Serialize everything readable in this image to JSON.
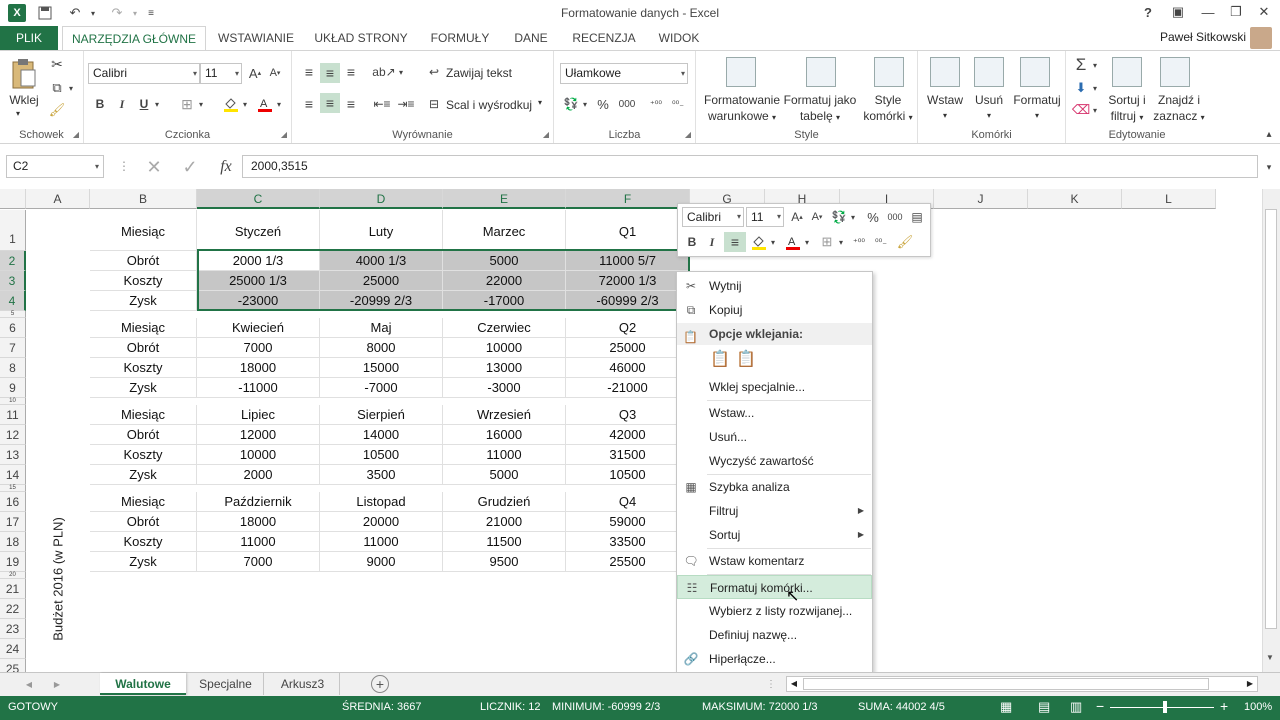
{
  "window": {
    "title": "Formatowanie danych - Excel",
    "help": "?",
    "user": "Paweł Sitkowski"
  },
  "tabs": [
    "PLIK",
    "NARZĘDZIA GŁÓWNE",
    "WSTAWIANIE",
    "UKŁAD STRONY",
    "FORMUŁY",
    "DANE",
    "RECENZJA",
    "WIDOK"
  ],
  "ribbon": {
    "clipboard": {
      "label": "Schowek",
      "paste": "Wklej"
    },
    "font": {
      "label": "Czcionka",
      "name": "Calibri",
      "size": "11"
    },
    "alignment": {
      "label": "Wyrównanie",
      "wrap": "Zawijaj tekst",
      "merge": "Scal i wyśrodkuj"
    },
    "number": {
      "label": "Liczba",
      "format": "Ułamkowe"
    },
    "styles": {
      "label": "Style",
      "cond1": "Formatowanie",
      "cond2": "warunkowe",
      "tbl1": "Formatuj jako",
      "tbl2": "tabelę",
      "cell1": "Style",
      "cell2": "komórki"
    },
    "cells": {
      "label": "Komórki",
      "insert": "Wstaw",
      "delete": "Usuń",
      "format": "Formatuj"
    },
    "editing": {
      "label": "Edytowanie",
      "sort1": "Sortuj i",
      "sort2": "filtruj",
      "find1": "Znajdź i",
      "find2": "zaznacz"
    }
  },
  "formula_bar": {
    "name_box": "C2",
    "content": "2000,3515"
  },
  "columns": [
    "A",
    "B",
    "C",
    "D",
    "E",
    "F",
    "G",
    "H",
    "I",
    "J",
    "K",
    "L"
  ],
  "rows": [
    "1",
    "2",
    "3",
    "4",
    "5",
    "6",
    "7",
    "8",
    "9",
    "10",
    "11",
    "12",
    "13",
    "14",
    "15",
    "16",
    "17",
    "18",
    "19",
    "20",
    "21",
    "22",
    "23",
    "24",
    "25"
  ],
  "side_label": "Budżet 2016 (w PLN)",
  "blocks": [
    {
      "header": [
        "Miesiąc",
        "Styczeń",
        "Luty",
        "Marzec",
        "Q1"
      ],
      "rows": [
        [
          "Obrót",
          "2000 1/3",
          "4000 1/3",
          "5000",
          "11000 5/7"
        ],
        [
          "Koszty",
          "25000 1/3",
          "25000",
          "22000",
          "72000 1/3"
        ],
        [
          "Zysk",
          "-23000",
          "-20999 2/3",
          "-17000",
          "-60999 2/3"
        ]
      ]
    },
    {
      "header": [
        "Miesiąc",
        "Kwiecień",
        "Maj",
        "Czerwiec",
        "Q2"
      ],
      "rows": [
        [
          "Obrót",
          "7000",
          "8000",
          "10000",
          "25000"
        ],
        [
          "Koszty",
          "18000",
          "15000",
          "13000",
          "46000"
        ],
        [
          "Zysk",
          "-11000",
          "-7000",
          "-3000",
          "-21000"
        ]
      ]
    },
    {
      "header": [
        "Miesiąc",
        "Lipiec",
        "Sierpień",
        "Wrzesień",
        "Q3"
      ],
      "rows": [
        [
          "Obrót",
          "12000",
          "14000",
          "16000",
          "42000"
        ],
        [
          "Koszty",
          "10000",
          "10500",
          "11000",
          "31500"
        ],
        [
          "Zysk",
          "2000",
          "3500",
          "5000",
          "10500"
        ]
      ]
    },
    {
      "header": [
        "Miesiąc",
        "Październik",
        "Listopad",
        "Grudzień",
        "Q4"
      ],
      "rows": [
        [
          "Obrót",
          "18000",
          "20000",
          "21000",
          "59000"
        ],
        [
          "Koszty",
          "11000",
          "11000",
          "11500",
          "33500"
        ],
        [
          "Zysk",
          "7000",
          "9000",
          "9500",
          "25500"
        ]
      ]
    }
  ],
  "mini_toolbar": {
    "font": "Calibri",
    "size": "11"
  },
  "context_menu": {
    "cut": "Wytnij",
    "copy": "Kopiuj",
    "paste_header": "Opcje wklejania:",
    "paste_special": "Wklej specjalnie...",
    "insert": "Wstaw...",
    "delete": "Usuń...",
    "clear": "Wyczyść zawartość",
    "quick": "Szybka analiza",
    "filter": "Filtruj",
    "sort": "Sortuj",
    "comment": "Wstaw komentarz",
    "format": "Formatuj komórki...",
    "pick": "Wybierz z listy rozwijanej...",
    "define": "Definiuj nazwę...",
    "link": "Hiperłącze..."
  },
  "sheets": [
    "Walutowe",
    "Specjalne",
    "Arkusz3"
  ],
  "status": {
    "ready": "GOTOWY",
    "avg": "ŚREDNIA: 3667",
    "count": "LICZNIK: 12",
    "min": "MINIMUM: -60999 2/3",
    "max": "MAKSIMUM: 72000 1/3",
    "sum": "SUMA: 44002 4/5",
    "zoom": "100%"
  },
  "colors": {
    "accent": "#217346",
    "selection": "#c6c6c6",
    "menu_hover": "#d4ecdc"
  }
}
